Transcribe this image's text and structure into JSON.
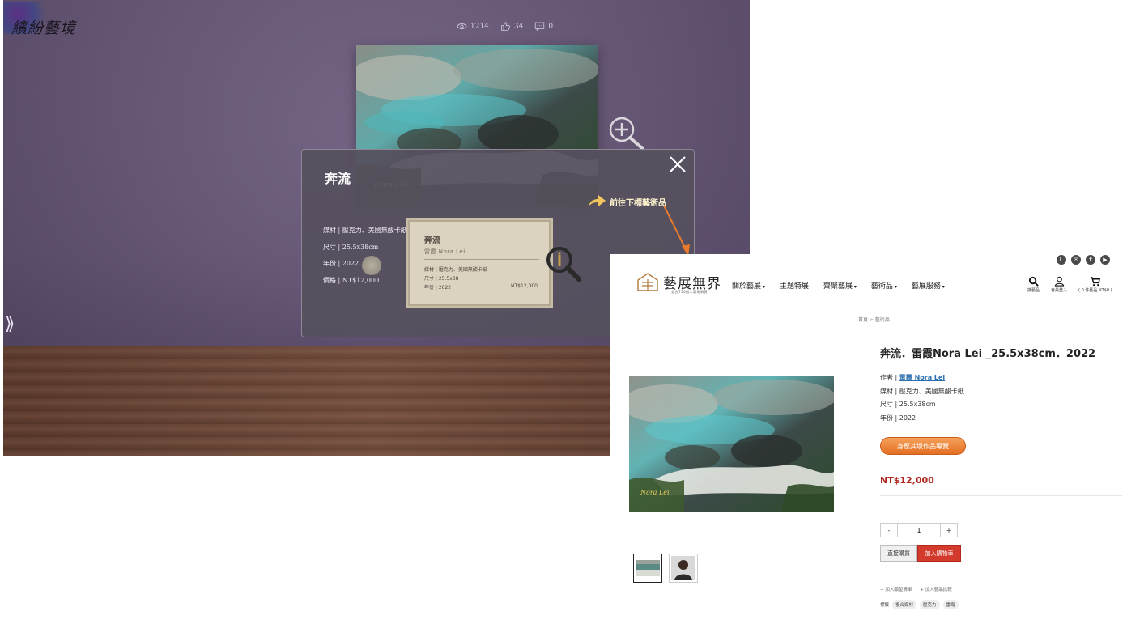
{
  "gallery": {
    "logo_text": "繽紛藝境",
    "stats": {
      "views": "1214",
      "likes": "34",
      "comments": "0"
    },
    "painting_signature": "Nora Lei",
    "modal": {
      "title": "奔流",
      "specs": [
        "媒材 | 壓克力、美國無酸卡紙",
        "尺寸 | 25.5x38cm",
        "年份 | 2022",
        "價格 | NT$12,000"
      ],
      "next_link": "前往下標藝術品",
      "label_card": {
        "title": "奔流",
        "artist": "雷霞 Nora Lei",
        "lines": [
          "媒材 | 壓克力、美國無酸卡紙",
          "尺寸 | 25.5x38",
          "年份 | 2022"
        ],
        "price": "NT$12,000"
      }
    },
    "prev_arrow": "⟫"
  },
  "shop": {
    "social_icons": [
      "line-icon",
      "mail-icon",
      "facebook-icon",
      "youtube-icon"
    ],
    "logo": {
      "name": "藝展無界",
      "tagline": "全台716個人藝術網頁"
    },
    "nav": [
      "關於藝展",
      "主題特展",
      "齊聚藝展",
      "藝術品",
      "藝展服務"
    ],
    "header_icons": {
      "search": "搜藝品",
      "member": "會員登入",
      "cart": "( 0 件藝品 NT$0 )"
    },
    "breadcrumb": [
      "首頁",
      "藝術品"
    ],
    "breadcrumb_sep": ">",
    "product": {
      "title": "奔流．雷霞Nora Lei _25.5x38cm．2022",
      "artist_label": "作者 | ",
      "artist_name": "雷霞 Nora Lei",
      "medium": "媒材 | 壓克力、美國無酸卡紙",
      "size": "尺寸 | 25.5x38cm",
      "year": "年份 | 2022",
      "tour_button": "身歷其境作品導覽",
      "price": "NT$12,000",
      "quantity": "1",
      "minus": "-",
      "plus": "+",
      "buy_now": "直接購買",
      "add_to_cart": "加入購物車",
      "wishlist": "+ 加入願望清單",
      "compare": "+ 加入藝品比較",
      "tags_label": "標籤",
      "tags": [
        "複合媒材",
        "壓克力",
        "雷霞"
      ]
    }
  },
  "colors": {
    "accent_orange": "#e36f23",
    "price_red": "#b1261c",
    "cart_red": "#d33a2c",
    "wall_purple": "#6a5a7c"
  }
}
